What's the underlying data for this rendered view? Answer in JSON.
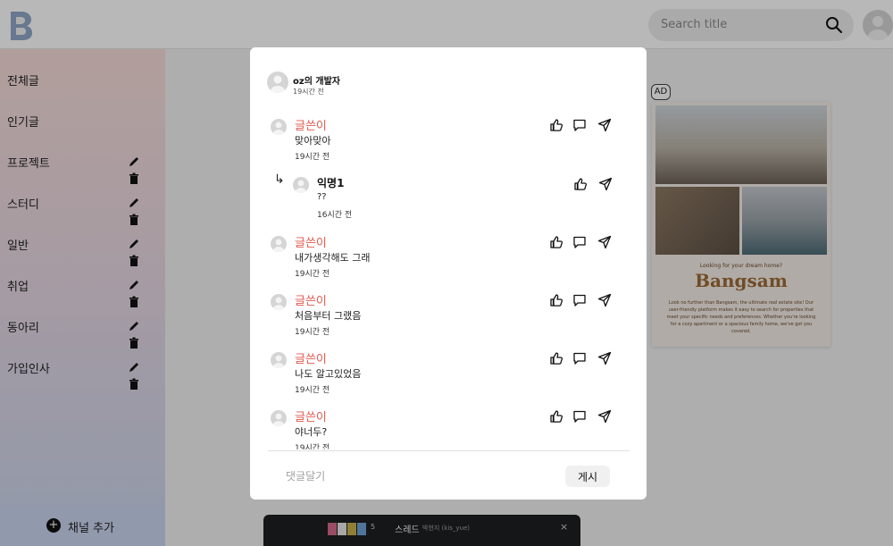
{
  "header": {
    "logo_letter": "B",
    "search_placeholder": "Search title",
    "icons": {
      "search": "search-icon",
      "profile": "user-avatar-icon"
    }
  },
  "sidebar": {
    "items": [
      {
        "label": "전체글",
        "editable": false
      },
      {
        "label": "인기글",
        "editable": false
      },
      {
        "label": "프로젝트",
        "editable": true
      },
      {
        "label": "스터디",
        "editable": true
      },
      {
        "label": "일반",
        "editable": true
      },
      {
        "label": "취업",
        "editable": true
      },
      {
        "label": "동아리",
        "editable": true
      },
      {
        "label": "가입인사",
        "editable": true
      }
    ],
    "add_channel_label": "채널 추가"
  },
  "ad": {
    "badge": "AD",
    "tagline": "Looking for your dream home?",
    "brand": "Bangsam",
    "body": "Look no further than Bangsam, the ultimate real estate site! Our user-friendly platform makes it easy to search for properties that meet your specific needs and preferences. Whether you're looking for a cozy apartment or a spacious family home, we've got you covered."
  },
  "thread_bar": {
    "count": "5",
    "title": "스레드",
    "user": "박현지 (kis_yue)",
    "close": "×"
  },
  "modal": {
    "post": {
      "author": "oz의 개발자",
      "time": "19시간 전"
    },
    "comments": [
      {
        "author": "글쓴이",
        "text": "맞아맞아",
        "time": "19시간 전"
      },
      {
        "author": "글쓴이",
        "text": "내가생각해도 그래",
        "time": "19시간 전"
      },
      {
        "author": "글쓴이",
        "text": "처음부터 그랬음",
        "time": "19시간 전"
      },
      {
        "author": "글쓴이",
        "text": "나도 알고있었음",
        "time": "19시간 전"
      },
      {
        "author": "글쓴이",
        "text": "야너두?",
        "time": "19시간 전"
      }
    ],
    "reply": {
      "author": "익명1",
      "text": "??",
      "time": "16시간 전",
      "arrow": "↳"
    },
    "input_placeholder": "댓글달기",
    "post_button": "게시"
  },
  "colors": {
    "comment_author": "#e05a4f",
    "overlay": "rgba(0,0,0,0.28)",
    "sidebar_top": "#f6dcd8",
    "sidebar_bottom": "#c9d5ec",
    "ad_brand": "#9b6a36"
  }
}
